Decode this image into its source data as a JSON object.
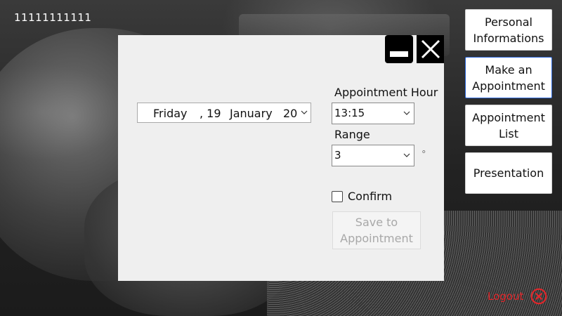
{
  "user_id": "11111111111",
  "dialog": {
    "date_picker": {
      "day_name": "Friday",
      "day_sep": ", 19",
      "month": "January",
      "year": "20"
    },
    "appointment_hour_label": "Appointment Hour",
    "appointment_hour_value": "13:15",
    "range_label": "Range",
    "range_value": "3",
    "range_unit": "°",
    "confirm_label": "Confirm",
    "confirm_checked": false,
    "save_button": "Save to\nAppointment"
  },
  "nav": {
    "personal_info": "Personal\nInformations",
    "make_appointment": "Make an\nAppointment",
    "appointment_list": "Appointment\nList",
    "presentation": "Presentation"
  },
  "logout_label": "Logout",
  "colors": {
    "accent_blue": "#2a66d9",
    "logout_red": "#e3262a",
    "dialog_bg": "#efefef"
  }
}
